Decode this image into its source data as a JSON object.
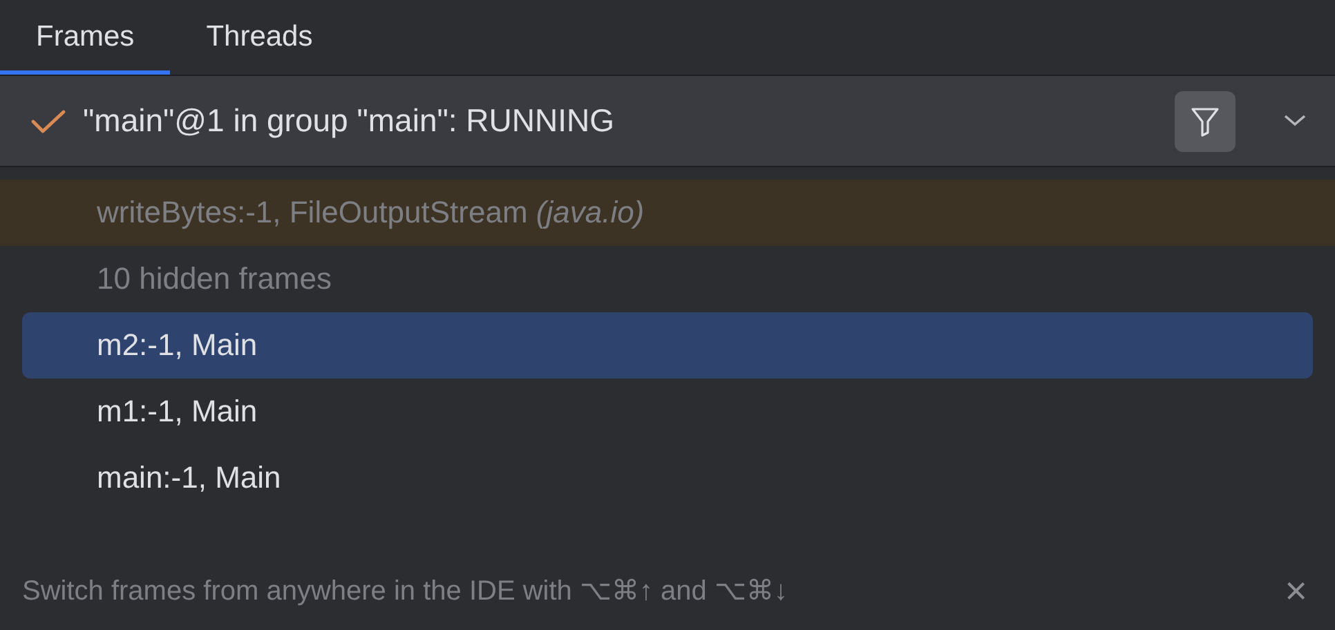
{
  "tabs": [
    {
      "label": "Frames",
      "selected": true
    },
    {
      "label": "Threads",
      "selected": false
    }
  ],
  "thread": {
    "label": "\"main\"@1 in group \"main\": RUNNING",
    "filter_on": true
  },
  "frames": [
    {
      "kind": "library",
      "text": "writeBytes:-1, FileOutputStream *(java.io)*",
      "selected": false
    },
    {
      "kind": "hidden",
      "text": "10 hidden frames",
      "selected": false
    },
    {
      "kind": "frame",
      "text": "m2:-1, Main",
      "selected": true
    },
    {
      "kind": "frame",
      "text": "m1:-1, Main",
      "selected": false
    },
    {
      "kind": "frame",
      "text": "main:-1, Main",
      "selected": false
    }
  ],
  "hint": {
    "text": "Switch frames from anywhere in the IDE with ⌥⌘↑ and ⌥⌘↓",
    "close": "×"
  }
}
